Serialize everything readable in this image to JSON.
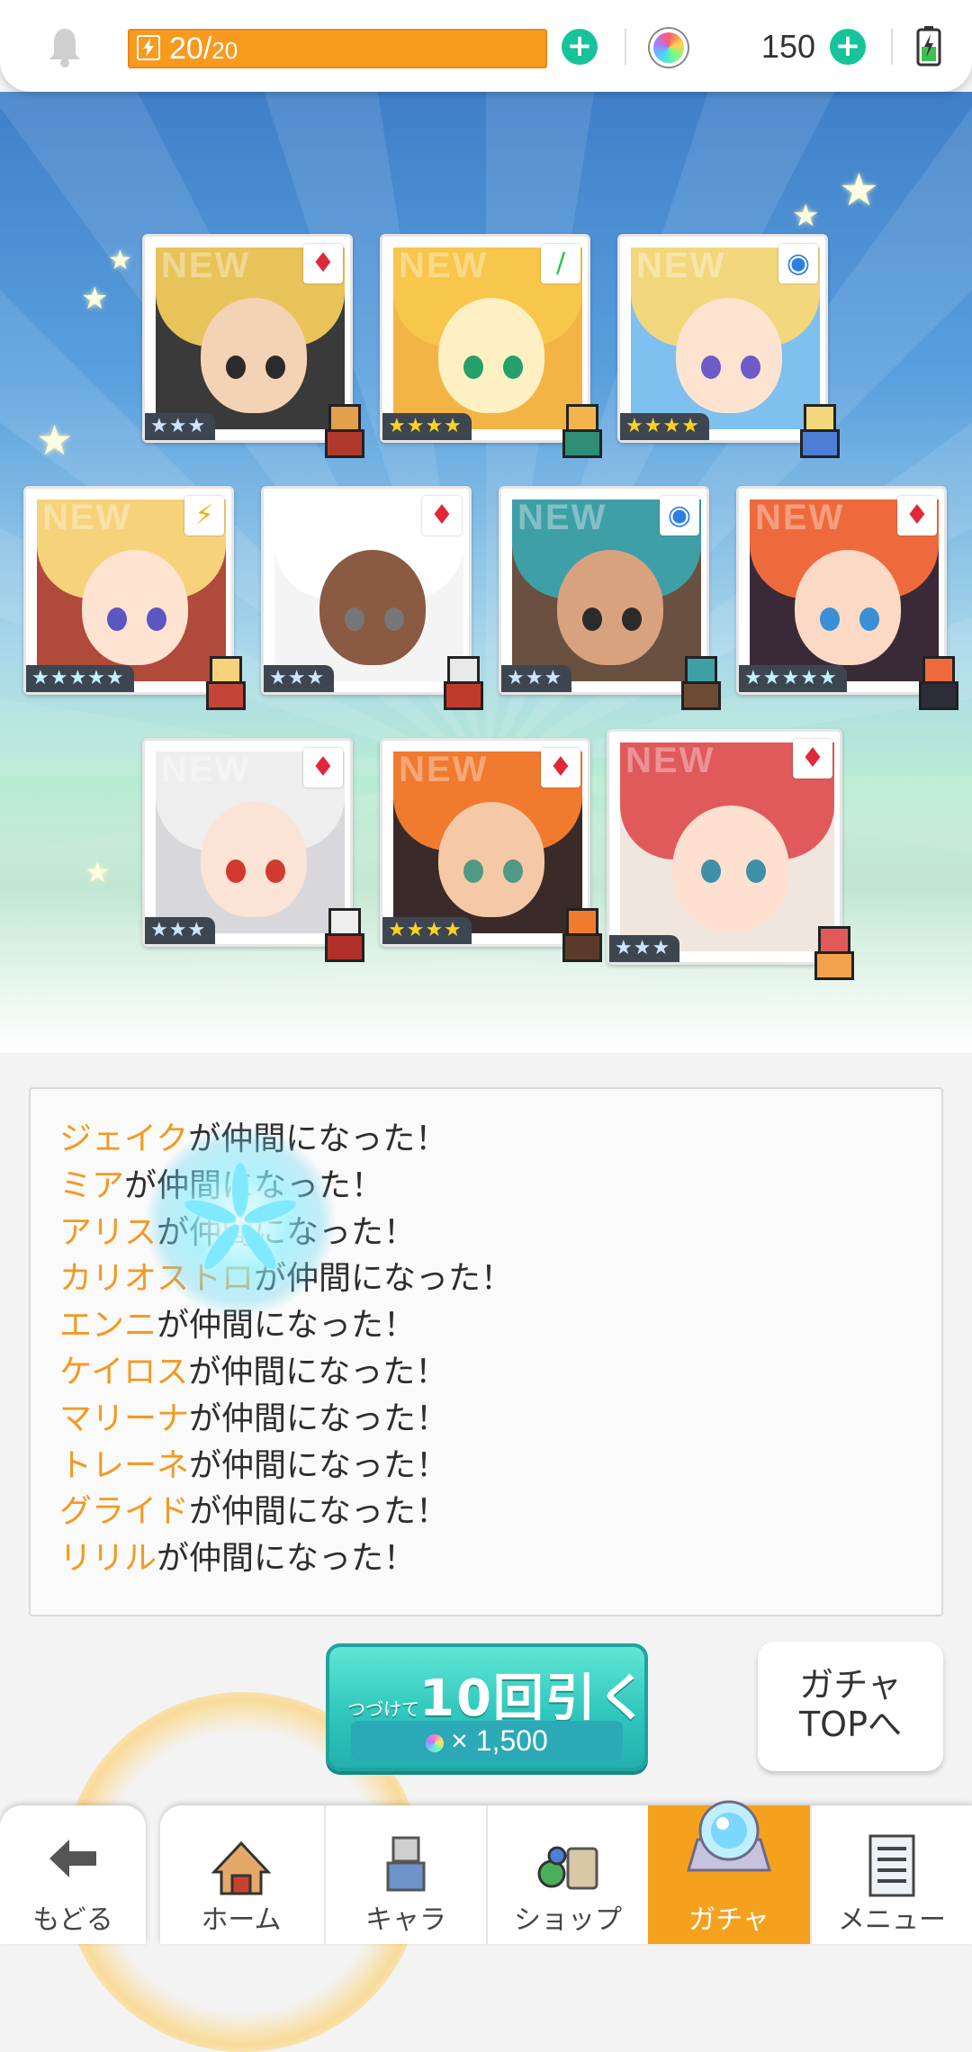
{
  "header": {
    "stamina_current": "20",
    "stamina_sep": "/",
    "stamina_max": "20",
    "gem_count": "150",
    "colors": {
      "stamina": "#f79a1e",
      "plus": "#17c39a"
    }
  },
  "cards_row1": [
    {
      "element": "fire",
      "element_symbol": "♦",
      "rarity": "★★★",
      "new": "NEW"
    },
    {
      "element": "wood",
      "element_symbol": "∕",
      "rarity": "★★★★",
      "new": "NEW"
    },
    {
      "element": "water",
      "element_symbol": "◉",
      "rarity": "★★★★",
      "new": "NEW"
    }
  ],
  "cards_row2": [
    {
      "element": "thunder",
      "element_symbol": "⚡",
      "rarity": "★★★★★",
      "new": "NEW"
    },
    {
      "element": "fire",
      "element_symbol": "♦",
      "rarity": "★★★",
      "new": "NEW"
    },
    {
      "element": "water",
      "element_symbol": "◉",
      "rarity": "★★★",
      "new": "NEW"
    },
    {
      "element": "fire",
      "element_symbol": "♦",
      "rarity": "★★★★★",
      "new": "NEW"
    }
  ],
  "cards_row3": [
    {
      "element": "fire",
      "element_symbol": "♦",
      "rarity": "★★★",
      "new": "NEW"
    },
    {
      "element": "fire",
      "element_symbol": "♦",
      "rarity": "★★★★",
      "new": "NEW"
    },
    {
      "element": "fire",
      "element_symbol": "♦",
      "rarity": "★★★",
      "new": "NEW"
    }
  ],
  "messages": {
    "suffix": "が仲間になった！",
    "names": [
      "ジェイク",
      "ミア",
      "アリス",
      "カリオストロ",
      "エンニ",
      "ケイロス",
      "マリーナ",
      "トレーネ",
      "グライド",
      "リリル"
    ]
  },
  "actions": {
    "pull_prefix": "つづけて",
    "pull_main": "10回引く",
    "pull_cost": "× 1,500",
    "gacha_top_line1": "ガチャ",
    "gacha_top_line2": "TOPへ"
  },
  "nav": {
    "back": "もどる",
    "home": "ホーム",
    "chara": "キャラ",
    "shop": "ショップ",
    "gacha": "ガチャ",
    "menu": "メニュー",
    "active": "gacha",
    "active_color": "#f6a11e"
  }
}
